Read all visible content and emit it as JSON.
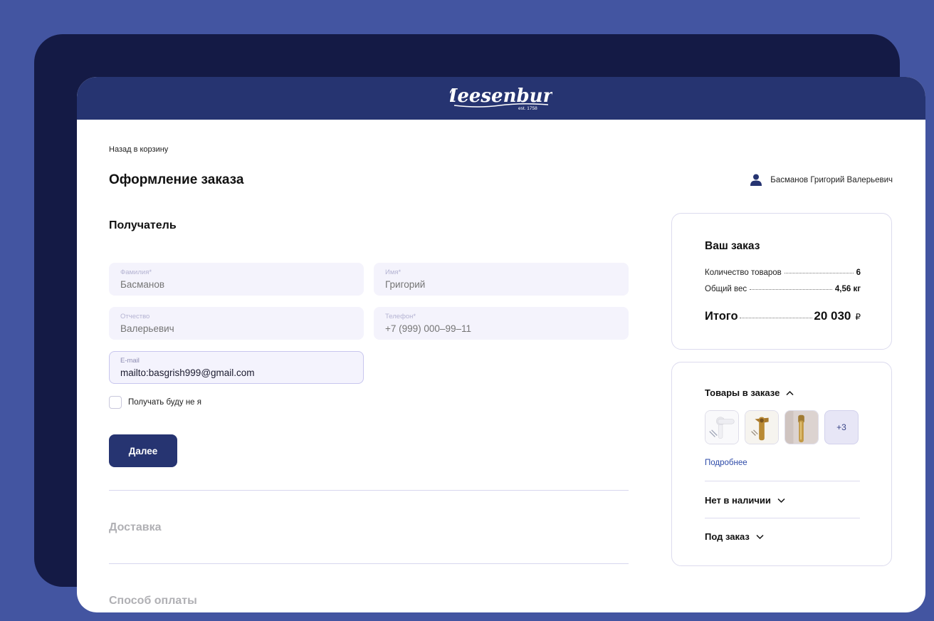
{
  "header": {
    "logo_text": "Meesenburg",
    "logo_sub": "est. 1758"
  },
  "nav": {
    "back_label": "Назад в корзину"
  },
  "page": {
    "title": "Оформление заказа"
  },
  "user": {
    "name": "Басманов Григорий Валерьевич"
  },
  "recipient": {
    "title": "Получатель",
    "fields": {
      "last_name": {
        "label": "Фамилия*",
        "placeholder": "Басманов"
      },
      "first_name": {
        "label": "Имя*",
        "placeholder": "Григорий"
      },
      "patronymic": {
        "label": "Отчество",
        "placeholder": "Валерьевич"
      },
      "phone": {
        "label": "Телефон*",
        "placeholder": "+7 (999) 000–99–11"
      },
      "email": {
        "label": "E-mail",
        "value": "mailto:basgrish999@gmail.com"
      }
    },
    "checkbox_label": "Получать буду не я",
    "next_label": "Далее"
  },
  "sections": {
    "delivery": "Доставка",
    "payment": "Способ оплаты"
  },
  "order": {
    "title": "Ваш заказ",
    "count_label": "Количество товаров",
    "count_value": "6",
    "weight_label": "Общий вес",
    "weight_value": "4,56 кг",
    "total_label": "Итого",
    "total_value": "20 030",
    "currency": "₽"
  },
  "items": {
    "title": "Товары в заказе",
    "more_count": "+3",
    "details_label": "Подробнее",
    "out_of_stock": "Нет в наличии",
    "pre_order": "Под заказ"
  },
  "colors": {
    "brand": "#263471",
    "frame": "#4355a1",
    "link": "#2d4aa8",
    "field_bg": "#f4f3fc"
  }
}
